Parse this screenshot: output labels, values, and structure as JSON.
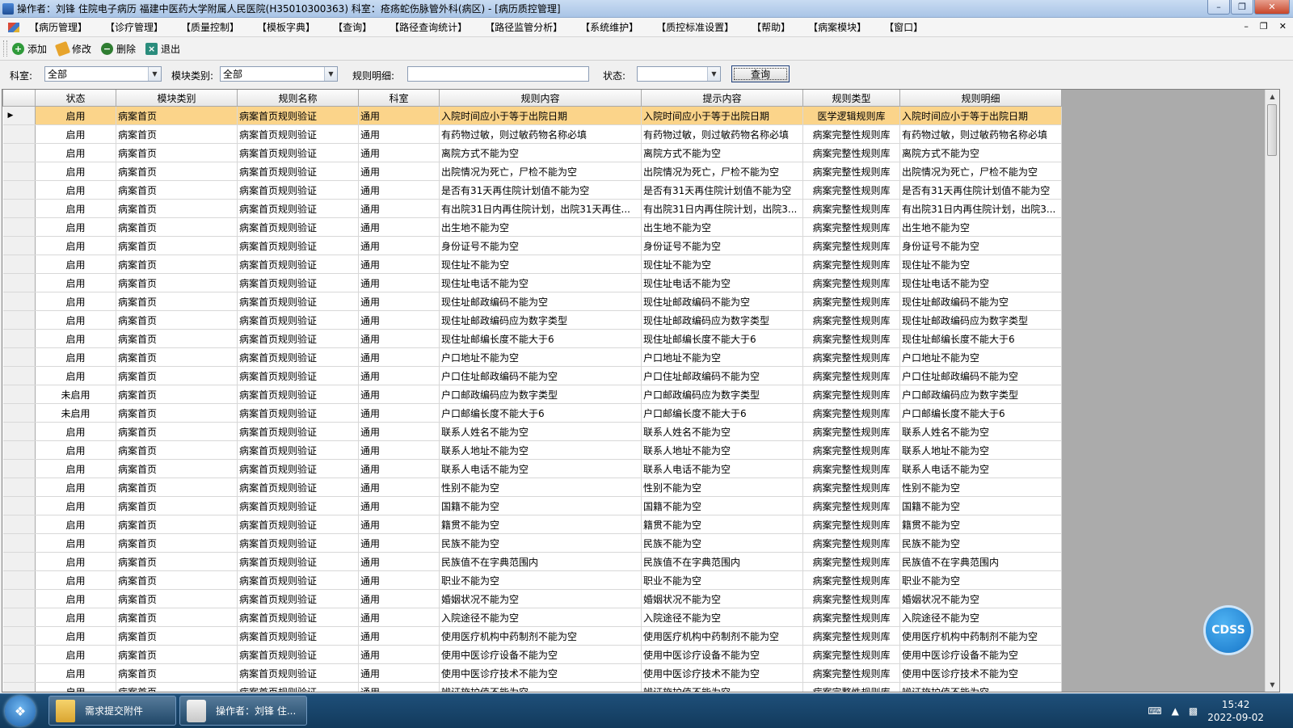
{
  "window": {
    "title": "操作者：刘锋  住院电子病历  福建中医药大学附属人民医院(H35010300363)  科室：疮疡蛇伤脉管外科(病区)  - [病历质控管理]"
  },
  "menu": [
    "【病历管理】",
    "【诊疗管理】",
    "【质量控制】",
    "【模板字典】",
    "【查询】",
    "【路径查询统计】",
    "【路径监管分析】",
    "【系统维护】",
    "【质控标准设置】",
    "【帮助】",
    "【病案模块】",
    "【窗口】"
  ],
  "toolbar": {
    "add": "添加",
    "edit": "修改",
    "delete": "删除",
    "exit": "退出"
  },
  "filters": {
    "dept_label": "科室:",
    "dept_value": "全部",
    "module_label": "模块类别:",
    "module_value": "全部",
    "rule_detail_label": "规则明细:",
    "rule_detail_value": "",
    "status_label": "状态:",
    "status_value": "",
    "query_button": "查询"
  },
  "grid": {
    "columns": [
      "状态",
      "模块类别",
      "规则名称",
      "科室",
      "规则内容",
      "提示内容",
      "规则类型",
      "规则明细"
    ],
    "rows": [
      [
        "启用",
        "病案首页",
        "病案首页规则验证",
        "通用",
        "入院时间应小于等于出院日期",
        "入院时间应小于等于出院日期",
        "医学逻辑规则库",
        "入院时间应小于等于出院日期"
      ],
      [
        "启用",
        "病案首页",
        "病案首页规则验证",
        "通用",
        "有药物过敏，则过敏药物名称必填",
        "有药物过敏，则过敏药物名称必填",
        "病案完整性规则库",
        "有药物过敏，则过敏药物名称必填"
      ],
      [
        "启用",
        "病案首页",
        "病案首页规则验证",
        "通用",
        "离院方式不能为空",
        "离院方式不能为空",
        "病案完整性规则库",
        "离院方式不能为空"
      ],
      [
        "启用",
        "病案首页",
        "病案首页规则验证",
        "通用",
        "出院情况为死亡，尸检不能为空",
        "出院情况为死亡，尸检不能为空",
        "病案完整性规则库",
        "出院情况为死亡，尸检不能为空"
      ],
      [
        "启用",
        "病案首页",
        "病案首页规则验证",
        "通用",
        "是否有31天再住院计划值不能为空",
        "是否有31天再住院计划值不能为空",
        "病案完整性规则库",
        "是否有31天再住院计划值不能为空"
      ],
      [
        "启用",
        "病案首页",
        "病案首页规则验证",
        "通用",
        "有出院31日内再住院计划，出院31天再住...",
        "有出院31日内再住院计划，出院3...",
        "病案完整性规则库",
        "有出院31日内再住院计划，出院3..."
      ],
      [
        "启用",
        "病案首页",
        "病案首页规则验证",
        "通用",
        "出生地不能为空",
        "出生地不能为空",
        "病案完整性规则库",
        "出生地不能为空"
      ],
      [
        "启用",
        "病案首页",
        "病案首页规则验证",
        "通用",
        "身份证号不能为空",
        "身份证号不能为空",
        "病案完整性规则库",
        "身份证号不能为空"
      ],
      [
        "启用",
        "病案首页",
        "病案首页规则验证",
        "通用",
        "现住址不能为空",
        "现住址不能为空",
        "病案完整性规则库",
        "现住址不能为空"
      ],
      [
        "启用",
        "病案首页",
        "病案首页规则验证",
        "通用",
        "现住址电话不能为空",
        "现住址电话不能为空",
        "病案完整性规则库",
        "现住址电话不能为空"
      ],
      [
        "启用",
        "病案首页",
        "病案首页规则验证",
        "通用",
        "现住址邮政编码不能为空",
        "现住址邮政编码不能为空",
        "病案完整性规则库",
        "现住址邮政编码不能为空"
      ],
      [
        "启用",
        "病案首页",
        "病案首页规则验证",
        "通用",
        "现住址邮政编码应为数字类型",
        "现住址邮政编码应为数字类型",
        "病案完整性规则库",
        "现住址邮政编码应为数字类型"
      ],
      [
        "启用",
        "病案首页",
        "病案首页规则验证",
        "通用",
        "现住址邮编长度不能大于6",
        "现住址邮编长度不能大于6",
        "病案完整性规则库",
        "现住址邮编长度不能大于6"
      ],
      [
        "启用",
        "病案首页",
        "病案首页规则验证",
        "通用",
        "户口地址不能为空",
        "户口地址不能为空",
        "病案完整性规则库",
        "户口地址不能为空"
      ],
      [
        "启用",
        "病案首页",
        "病案首页规则验证",
        "通用",
        "户口住址邮政编码不能为空",
        "户口住址邮政编码不能为空",
        "病案完整性规则库",
        "户口住址邮政编码不能为空"
      ],
      [
        "未启用",
        "病案首页",
        "病案首页规则验证",
        "通用",
        "户口邮政编码应为数字类型",
        "户口邮政编码应为数字类型",
        "病案完整性规则库",
        "户口邮政编码应为数字类型"
      ],
      [
        "未启用",
        "病案首页",
        "病案首页规则验证",
        "通用",
        "户口邮编长度不能大于6",
        "户口邮编长度不能大于6",
        "病案完整性规则库",
        "户口邮编长度不能大于6"
      ],
      [
        "启用",
        "病案首页",
        "病案首页规则验证",
        "通用",
        "联系人姓名不能为空",
        "联系人姓名不能为空",
        "病案完整性规则库",
        "联系人姓名不能为空"
      ],
      [
        "启用",
        "病案首页",
        "病案首页规则验证",
        "通用",
        "联系人地址不能为空",
        "联系人地址不能为空",
        "病案完整性规则库",
        "联系人地址不能为空"
      ],
      [
        "启用",
        "病案首页",
        "病案首页规则验证",
        "通用",
        "联系人电话不能为空",
        "联系人电话不能为空",
        "病案完整性规则库",
        "联系人电话不能为空"
      ],
      [
        "启用",
        "病案首页",
        "病案首页规则验证",
        "通用",
        "性别不能为空",
        "性别不能为空",
        "病案完整性规则库",
        "性别不能为空"
      ],
      [
        "启用",
        "病案首页",
        "病案首页规则验证",
        "通用",
        "国籍不能为空",
        "国籍不能为空",
        "病案完整性规则库",
        "国籍不能为空"
      ],
      [
        "启用",
        "病案首页",
        "病案首页规则验证",
        "通用",
        "籍贯不能为空",
        "籍贯不能为空",
        "病案完整性规则库",
        "籍贯不能为空"
      ],
      [
        "启用",
        "病案首页",
        "病案首页规则验证",
        "通用",
        "民族不能为空",
        "民族不能为空",
        "病案完整性规则库",
        "民族不能为空"
      ],
      [
        "启用",
        "病案首页",
        "病案首页规则验证",
        "通用",
        "民族值不在字典范围内",
        "民族值不在字典范围内",
        "病案完整性规则库",
        "民族值不在字典范围内"
      ],
      [
        "启用",
        "病案首页",
        "病案首页规则验证",
        "通用",
        "职业不能为空",
        "职业不能为空",
        "病案完整性规则库",
        "职业不能为空"
      ],
      [
        "启用",
        "病案首页",
        "病案首页规则验证",
        "通用",
        "婚姻状况不能为空",
        "婚姻状况不能为空",
        "病案完整性规则库",
        "婚姻状况不能为空"
      ],
      [
        "启用",
        "病案首页",
        "病案首页规则验证",
        "通用",
        "入院途径不能为空",
        "入院途径不能为空",
        "病案完整性规则库",
        "入院途径不能为空"
      ],
      [
        "启用",
        "病案首页",
        "病案首页规则验证",
        "通用",
        "使用医疗机构中药制剂不能为空",
        "使用医疗机构中药制剂不能为空",
        "病案完整性规则库",
        "使用医疗机构中药制剂不能为空"
      ],
      [
        "启用",
        "病案首页",
        "病案首页规则验证",
        "通用",
        "使用中医诊疗设备不能为空",
        "使用中医诊疗设备不能为空",
        "病案完整性规则库",
        "使用中医诊疗设备不能为空"
      ],
      [
        "启用",
        "病案首页",
        "病案首页规则验证",
        "通用",
        "使用中医诊疗技术不能为空",
        "使用中医诊疗技术不能为空",
        "病案完整性规则库",
        "使用中医诊疗技术不能为空"
      ],
      [
        "启用",
        "病案首页",
        "病案首页规则验证",
        "通用",
        "辨证施护值不能为空",
        "辨证施护值不能为空",
        "病案完整性规则库",
        "辨证施护值不能为空"
      ]
    ],
    "selected_row": 0
  },
  "cdss": "CDSS",
  "taskbar": {
    "tasks": [
      "需求提交附件",
      "操作者：刘锋 住..."
    ],
    "time": "15:42",
    "date": "2022-09-02"
  }
}
